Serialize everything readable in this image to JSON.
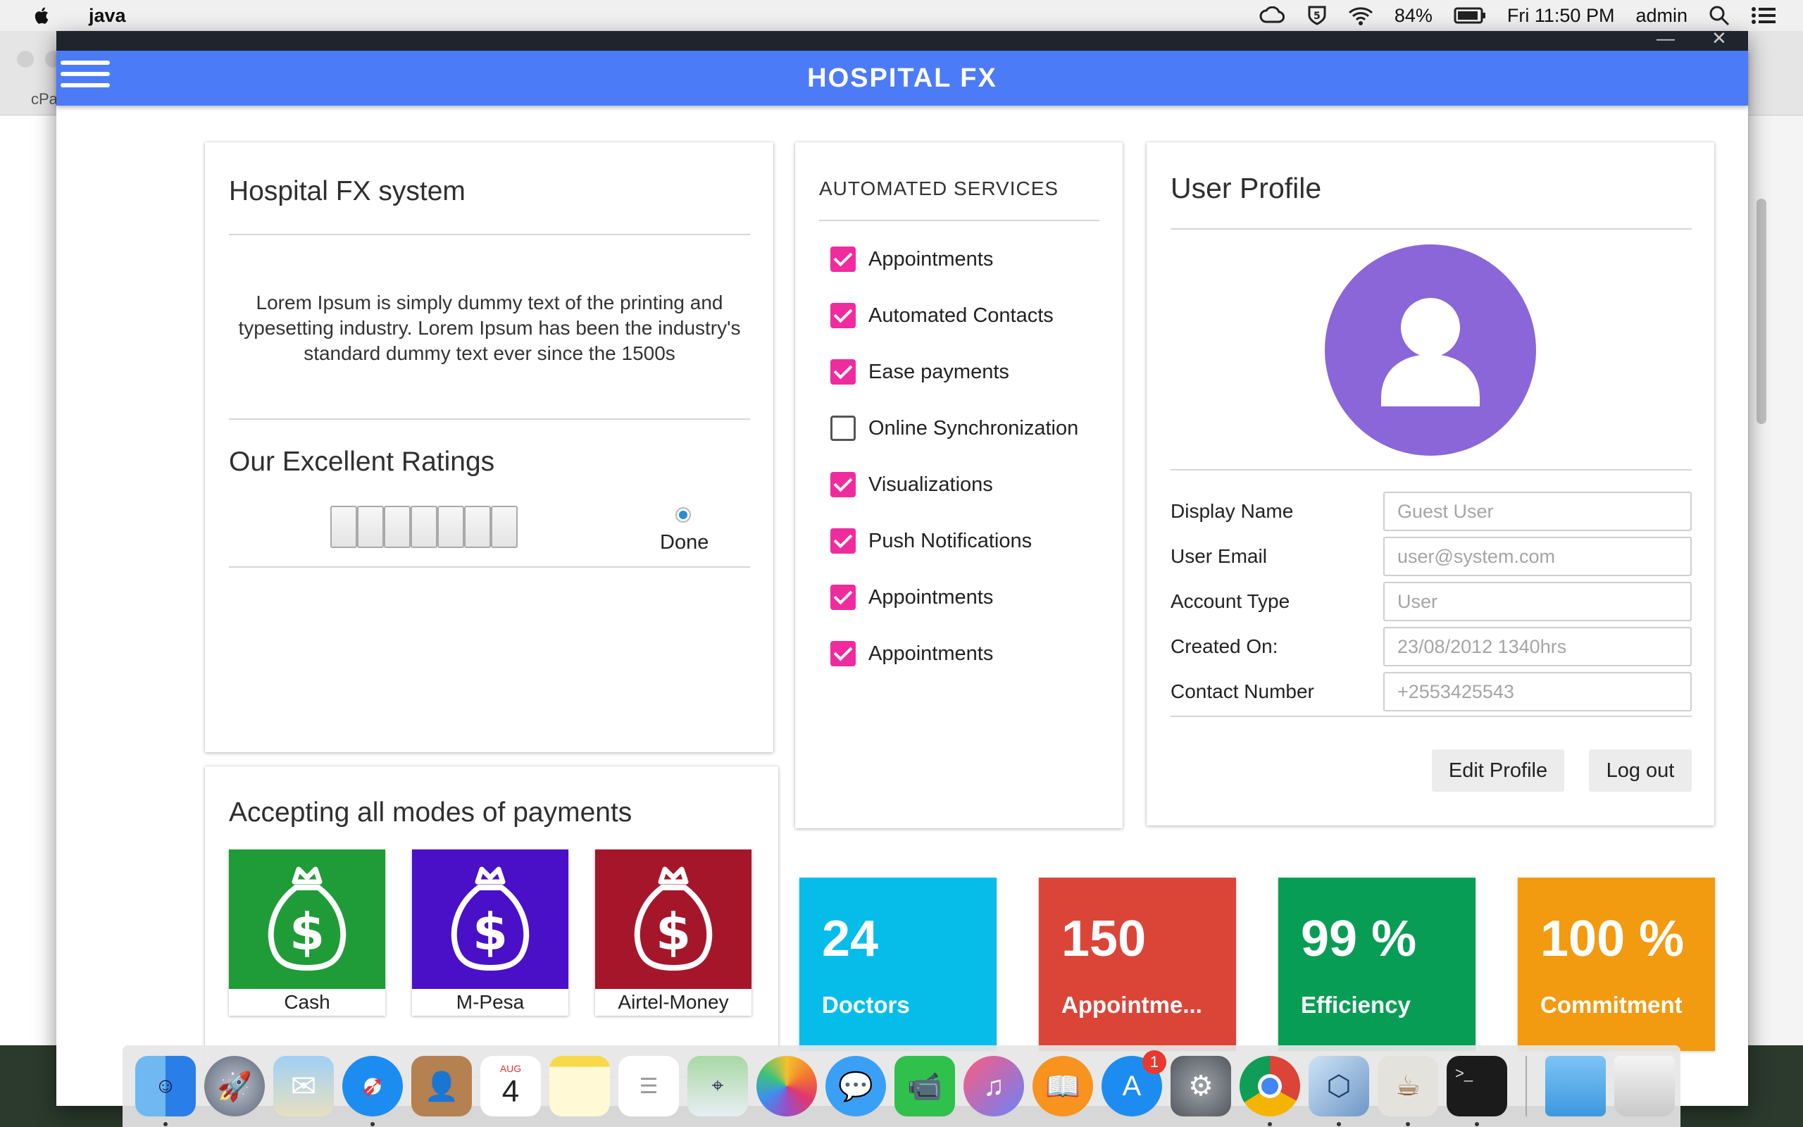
{
  "menubar": {
    "app_name": "java",
    "battery": "84%",
    "clock": "Fri 11:50 PM",
    "user": "admin"
  },
  "background_browser": {
    "tab_text": "cPa"
  },
  "app": {
    "title": "HOSPITAL FX",
    "accent": "#4c7bf8"
  },
  "info_card": {
    "title": "Hospital FX system",
    "body": "Lorem Ipsum is simply dummy text of the printing and typesetting industry. Lorem Ipsum has been the industry's standard dummy text ever since the 1500s",
    "ratings_title": "Our Excellent Ratings",
    "rating_segments": 7,
    "done_label": "Done"
  },
  "services_card": {
    "title": "AUTOMATED SERVICES",
    "items": [
      {
        "label": "Appointments",
        "checked": true
      },
      {
        "label": "Automated Contacts",
        "checked": true
      },
      {
        "label": "Ease payments",
        "checked": true
      },
      {
        "label": "Online Synchronization",
        "checked": false
      },
      {
        "label": "Visualizations",
        "checked": true
      },
      {
        "label": "Push Notifications",
        "checked": true
      },
      {
        "label": "Appointments",
        "checked": true
      },
      {
        "label": "Appointments",
        "checked": true
      }
    ],
    "check_color": "#f02b9e"
  },
  "profile_card": {
    "title": "User Profile",
    "avatar_color": "#8a66d9",
    "fields": [
      {
        "label": "Display Name",
        "placeholder": "Guest User"
      },
      {
        "label": "User Email",
        "placeholder": "user@system.com"
      },
      {
        "label": "Account Type",
        "placeholder": "User"
      },
      {
        "label": "Created On:",
        "placeholder": "23/08/2012 1340hrs"
      },
      {
        "label": "Contact Number",
        "placeholder": "+2553425543"
      }
    ],
    "edit_button": "Edit Profile",
    "logout_button": "Log out"
  },
  "payments_card": {
    "title": "Accepting all modes of payments",
    "methods": [
      {
        "label": "Cash",
        "color": "#1f9c37"
      },
      {
        "label": "M-Pesa",
        "color": "#4a10c8"
      },
      {
        "label": "Airtel-Money",
        "color": "#a6162a"
      }
    ]
  },
  "stats": [
    {
      "value": "24",
      "label": "Doctors",
      "color": "#06bdea"
    },
    {
      "value": "150",
      "label": "Appointme...",
      "color": "#db4538"
    },
    {
      "value": "99 %",
      "label": "Efficiency",
      "color": "#079d55"
    },
    {
      "value": "100 %",
      "label": "Commitment",
      "color": "#f29a10"
    }
  ],
  "dock": {
    "calendar_month": "AUG",
    "calendar_day": "4",
    "appstore_badge": "1"
  }
}
